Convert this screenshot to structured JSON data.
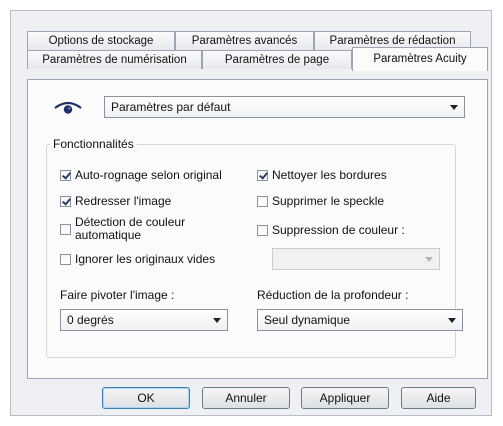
{
  "tabs_row1": [
    "Options de stockage",
    "Paramètres avancés",
    "Paramètres de rédaction"
  ],
  "tabs_row2": [
    "Paramètres de numérisation",
    "Paramètres de page",
    "Paramètres Acuity"
  ],
  "active_tab": "Paramètres Acuity",
  "profile": {
    "icon": "eye-icon",
    "selected": "Paramètres par défaut"
  },
  "features": {
    "legend": "Fonctionnalités",
    "auto_crop": {
      "label": "Auto-rognage selon original",
      "checked": true
    },
    "straighten": {
      "label": "Redresser l'image",
      "checked": true
    },
    "color_detect": {
      "label": "Détection de couleur automatique",
      "line1": "Détection de couleur",
      "line2": "automatique",
      "checked": false
    },
    "ignore_blank": {
      "label": "Ignorer les originaux vides",
      "checked": false
    },
    "clean_borders": {
      "label": "Nettoyer les bordures",
      "checked": true
    },
    "remove_speckle": {
      "label": "Supprimer le speckle",
      "checked": false
    },
    "color_removal": {
      "label": "Suppression de couleur :",
      "checked": false,
      "selected": ""
    },
    "rotate": {
      "label": "Faire pivoter l'image :",
      "selected": "0 degrés"
    },
    "depth": {
      "label": "Réduction de la profondeur :",
      "selected": "Seul dynamique"
    }
  },
  "buttons": {
    "ok": "OK",
    "cancel": "Annuler",
    "apply": "Appliquer",
    "help": "Aide"
  }
}
